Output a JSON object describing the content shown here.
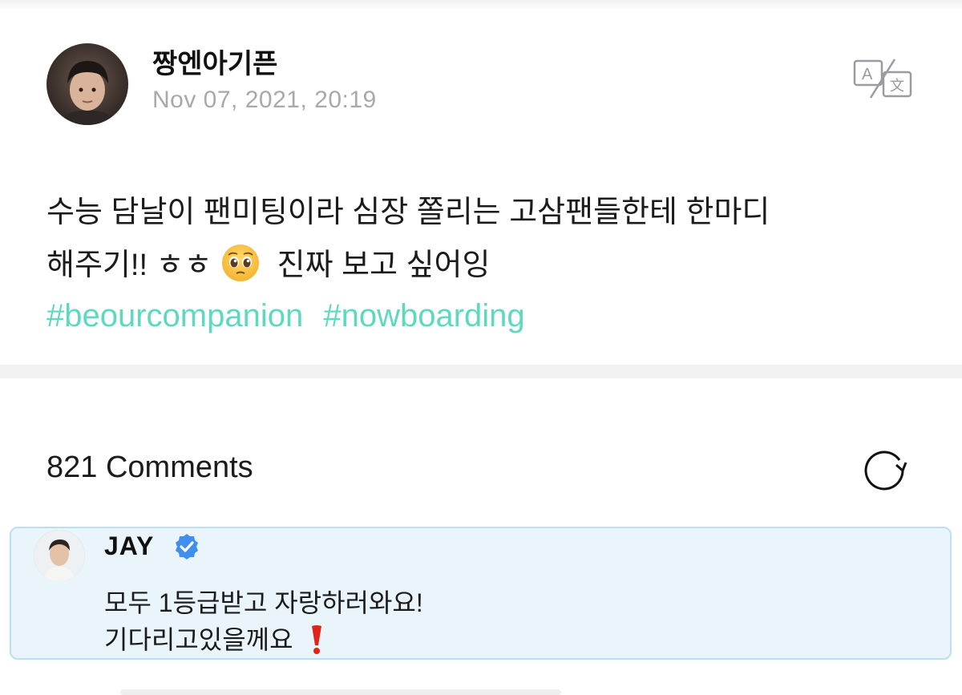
{
  "post": {
    "author": "짱엔아기픈",
    "timestamp": "Nov 07, 2021, 20:19",
    "text_line1": "수능 담날이 팬미팅이라 심장 쫄리는 고삼팬들한테 한마디",
    "text_line2_before": "해주기!! ㅎㅎ",
    "text_line2_after": "진짜 보고 싶어잉",
    "emoji": "pleading-face-emoji",
    "hashtags": [
      "#beourcompanion",
      "#nowboarding"
    ],
    "translate_icon": "translate-icon"
  },
  "comments": {
    "header": "821 Comments",
    "refresh_icon": "refresh-icon",
    "items": [
      {
        "author": "JAY",
        "verified": true,
        "line1": "모두 1등급받고 자랑하러와요!",
        "line2": "기다리고있을께요",
        "emoji": "red-exclamation-mark"
      }
    ]
  },
  "colors": {
    "hashtag": "#5fd8c0",
    "highlight_bg": "#e9f5fb",
    "highlight_border": "#b9e1ef",
    "verified_blue": "#3f8ff0",
    "timestamp_gray": "#a8a8ad"
  }
}
